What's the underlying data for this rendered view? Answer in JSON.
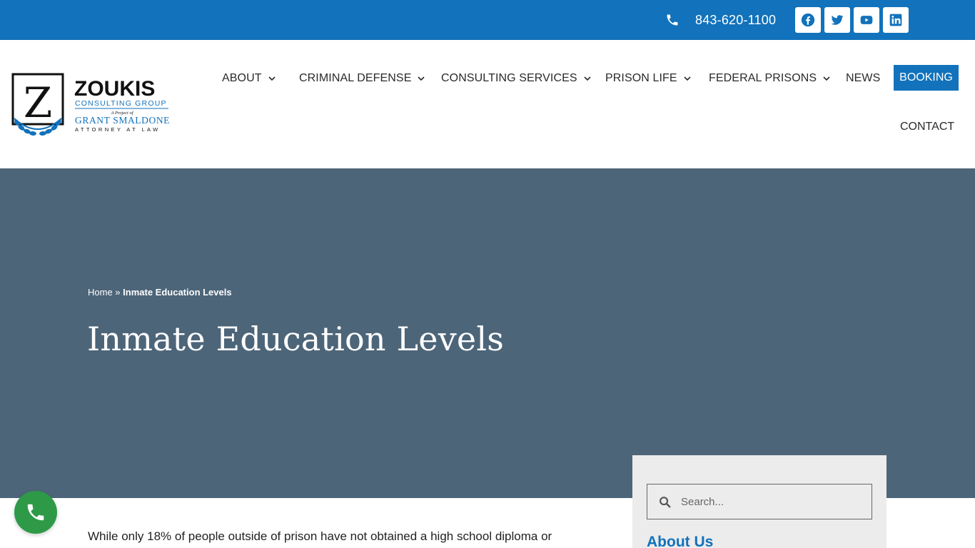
{
  "topbar": {
    "phone": "843-620-1100",
    "phone_icon": "phone-icon",
    "social": [
      "facebook-icon",
      "twitter-icon",
      "youtube-icon",
      "linkedin-icon"
    ]
  },
  "logo": {
    "name": "ZOUKIS",
    "tagline": "CONSULTING GROUP",
    "project_of": "A Project of",
    "firm": "GRANT SMALDONE",
    "firm_sub": "ATTORNEY AT LAW",
    "letter": "Z"
  },
  "nav": {
    "about": "ABOUT",
    "criminal_defense": "CRIMINAL DEFENSE",
    "consulting_services": "CONSULTING SERVICES",
    "prison_life": "PRISON LIFE",
    "federal_prisons": "FEDERAL PRISONS",
    "news": "NEWS",
    "booking": "BOOKING",
    "contact": "CONTACT"
  },
  "hero": {
    "breadcrumb_home": "Home",
    "breadcrumb_sep": " » ",
    "breadcrumb_current": "Inmate Education Levels",
    "title": "Inmate Education Levels"
  },
  "sidebar": {
    "search_placeholder": "Search...",
    "about_heading": "About Us"
  },
  "content": {
    "intro": "While only 18% of people outside of prison have not obtained a high school diploma or"
  },
  "colors": {
    "brand_blue": "#1272bb",
    "hero_bg": "#4d6579",
    "call_green": "#2e9a48"
  }
}
